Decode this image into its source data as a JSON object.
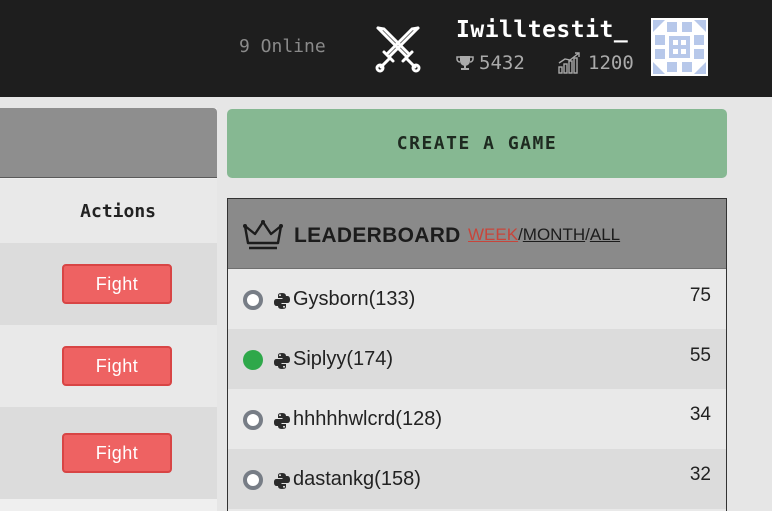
{
  "header": {
    "online_text": "9 Online",
    "username": "Iwilltestit_",
    "trophies": "5432",
    "rating": "1200",
    "icons": [
      "crossed-swords-icon",
      "trophy-icon",
      "rating-chart-icon",
      "identicon-avatar"
    ]
  },
  "left_panel": {
    "actions_label": "Actions",
    "rows": [
      {
        "button_label": "Fight"
      },
      {
        "button_label": "Fight"
      },
      {
        "button_label": "Fight"
      }
    ]
  },
  "create_game": {
    "label": "CREATE A GAME"
  },
  "leaderboard": {
    "title": "LEADERBOARD",
    "filters": [
      "WEEK",
      "MONTH",
      "ALL"
    ],
    "active_filter": "WEEK",
    "separator": "/",
    "rows": [
      {
        "name": "Gysborn(133)",
        "score": "75",
        "status": "offline"
      },
      {
        "name": "Siplyy(174)",
        "score": "55",
        "status": "online"
      },
      {
        "name": "hhhhhwlcrd(128)",
        "score": "34",
        "status": "offline"
      },
      {
        "name": "dastankg(158)",
        "score": "32",
        "status": "offline"
      }
    ]
  },
  "colors": {
    "header_bg": "#1e1e1e",
    "create_button": "#86b892",
    "fight_button": "#ee6262",
    "online_dot": "#2ea84a",
    "active_filter": "#c8453b"
  }
}
